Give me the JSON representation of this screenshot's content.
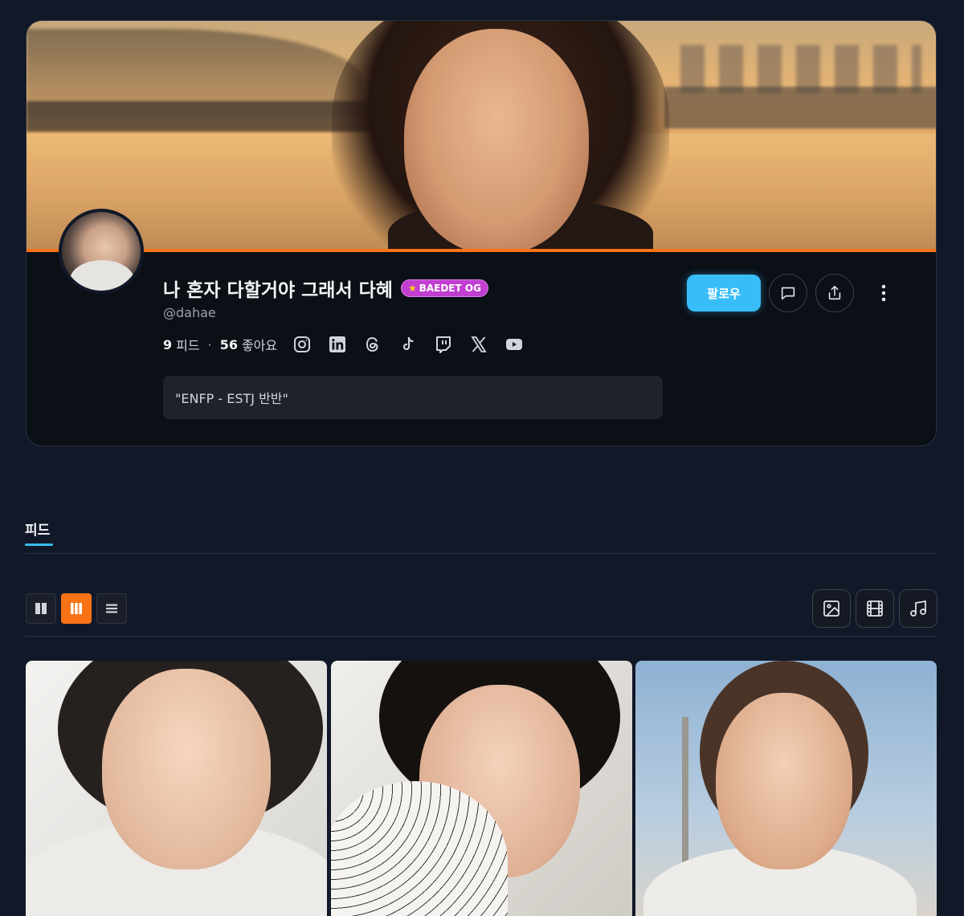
{
  "profile": {
    "display_name": "나 혼자 다할거야 그래서 다혜",
    "badge": {
      "star": "★",
      "label": "BAEDET OG"
    },
    "handle": "@dahae",
    "stats": {
      "feeds_count": "9",
      "feeds_label": "피드",
      "separator": "·",
      "likes_count": "56",
      "likes_label": "좋아요"
    },
    "social_icons": [
      "instagram-icon",
      "linkedin-icon",
      "threads-icon",
      "tiktok-icon",
      "twitch-icon",
      "x-icon",
      "youtube-icon"
    ],
    "bio": "\"ENFP - ESTJ 반반\""
  },
  "actions": {
    "follow_label": "팔로우",
    "icons": [
      "message-icon",
      "share-icon",
      "more-vertical-icon"
    ]
  },
  "tabs": [
    {
      "label": "피드",
      "active": true
    }
  ],
  "toolbar": {
    "layout_options": [
      "two-column-grid-icon",
      "three-column-grid-icon",
      "list-icon"
    ],
    "active_layout": "three-column-grid-icon",
    "media_filters": [
      "image-icon",
      "video-icon",
      "music-icon"
    ]
  },
  "colors": {
    "background": "#111827",
    "accent_orange": "#f97316",
    "accent_blue": "#38bdf8",
    "badge_purple": "#c13fd0"
  }
}
